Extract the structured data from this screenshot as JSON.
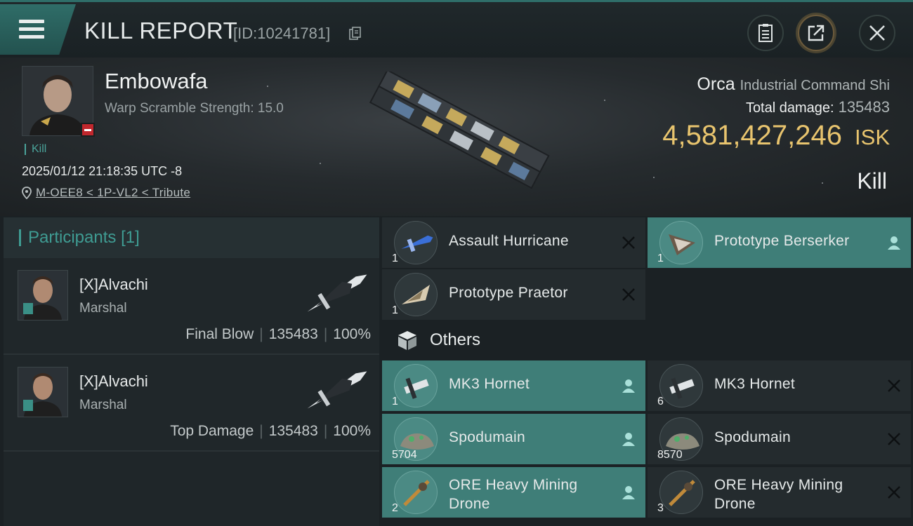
{
  "header": {
    "title": "KILL REPORT",
    "report_id": "[ID:10241781]"
  },
  "victim": {
    "name": "Embowafa",
    "warp_scramble": "Warp Scramble Strength: 15.0",
    "tag": "Kill",
    "datetime": "2025/01/12 21:18:35 UTC -8",
    "location": "M-OEE8 < 1P-VL2 < Tribute"
  },
  "summary": {
    "ship_name": "Orca",
    "ship_class": "Industrial Command Shi",
    "damage_label": "Total damage:",
    "damage_value": "135483",
    "isk_value": "4,581,427,246",
    "isk_unit": "ISK",
    "result": "Kill"
  },
  "participants": {
    "label": "Participants",
    "count": "[1]",
    "rows": [
      {
        "name": "[X]Alvachi",
        "ship": "Marshal",
        "role": "Final Blow",
        "damage": "135483",
        "percent": "100%"
      },
      {
        "name": "[X]Alvachi",
        "ship": "Marshal",
        "role": "Top Damage",
        "damage": "135483",
        "percent": "100%"
      }
    ]
  },
  "items": {
    "fitted": [
      {
        "name": "Assault Hurricane",
        "qty": "1",
        "action": "close-icon"
      },
      {
        "name": "Prototype  Berserker",
        "qty": "1",
        "action": "person-icon"
      },
      {
        "name": "Prototype  Praetor",
        "qty": "1",
        "action": "close-icon"
      }
    ],
    "others_label": "Others",
    "others": [
      {
        "name": "MK3  Hornet",
        "qty": "1",
        "action": "person-icon"
      },
      {
        "name": "MK3  Hornet",
        "qty": "6",
        "action": "close-icon"
      },
      {
        "name": "Spodumain",
        "qty": "5704",
        "action": "person-icon"
      },
      {
        "name": "Spodumain",
        "qty": "8570",
        "action": "close-icon"
      },
      {
        "name": "ORE Heavy Mining Drone",
        "qty": "2",
        "action": "person-icon"
      },
      {
        "name": "ORE Heavy Mining Drone",
        "qty": "3",
        "action": "close-icon"
      }
    ]
  },
  "colors": {
    "accent_teal": "#3f9c93",
    "isk_gold": "#e8c46e",
    "highlight_cell": "#3f7e78",
    "destroyed_red": "#c1272d"
  }
}
